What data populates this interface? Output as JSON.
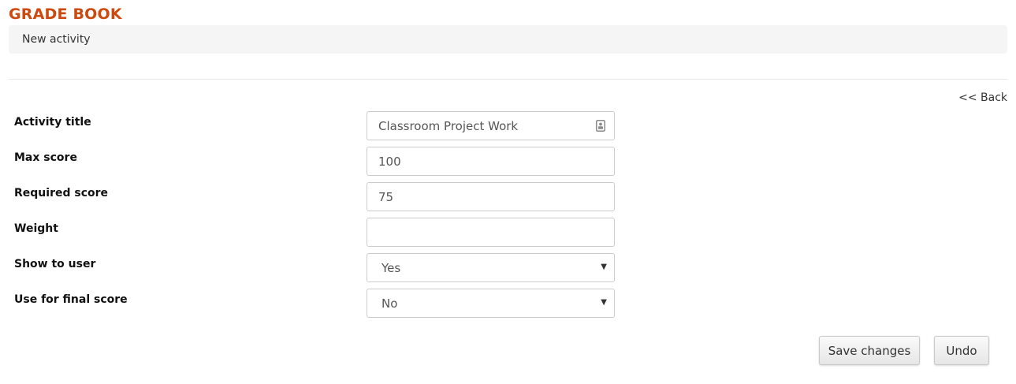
{
  "header": {
    "title": "GRADE BOOK",
    "title_color": "#cc4a0f"
  },
  "breadcrumb": {
    "current": "New activity"
  },
  "nav": {
    "back_label": "<< Back"
  },
  "form": {
    "fields": [
      {
        "label": "Activity title",
        "value": "Classroom Project Work",
        "type": "text",
        "icon": "contact-card-icon"
      },
      {
        "label": "Max score",
        "value": "100",
        "type": "text"
      },
      {
        "label": "Required score",
        "value": "75",
        "type": "text"
      },
      {
        "label": "Weight",
        "value": "",
        "type": "text"
      },
      {
        "label": "Show to user",
        "value": "Yes",
        "type": "select"
      },
      {
        "label": "Use for final score",
        "value": "No",
        "type": "select"
      }
    ]
  },
  "actions": {
    "save_label": "Save changes",
    "undo_label": "Undo"
  }
}
